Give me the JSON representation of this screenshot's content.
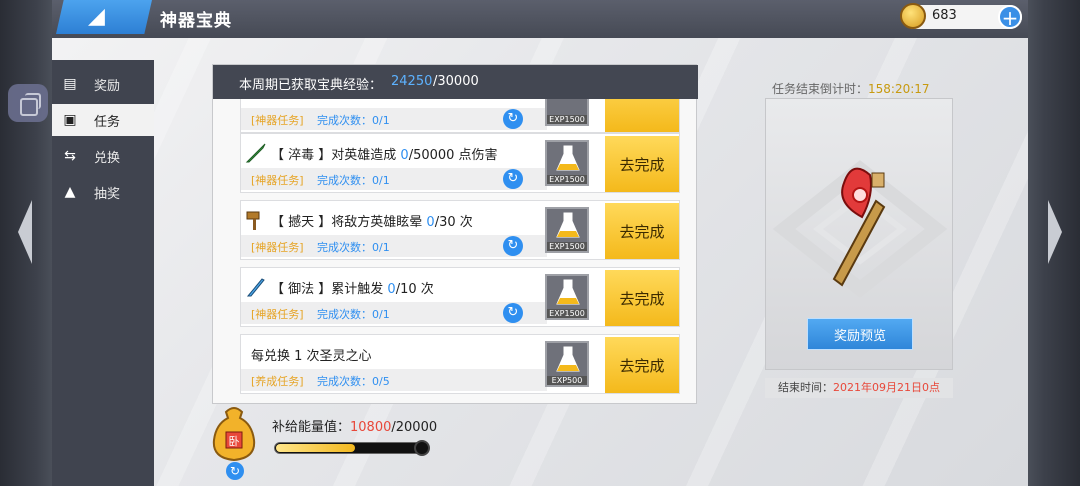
{
  "header": {
    "title": "神器宝典",
    "back_glyph": "◢"
  },
  "currency": {
    "amount": "683",
    "plus": "+"
  },
  "sidebar": {
    "items": [
      {
        "label": "奖励",
        "icon": "reward-icon"
      },
      {
        "label": "任务",
        "icon": "task-icon"
      },
      {
        "label": "兑换",
        "icon": "exchange-icon"
      },
      {
        "label": "抽奖",
        "icon": "lottery-icon"
      }
    ]
  },
  "panel": {
    "exp_label": "本周期已获取宝典经验：",
    "exp_current": "24250",
    "exp_total": "/30000"
  },
  "tasks": [
    {
      "prefix": "",
      "title": "",
      "progress_current": "",
      "progress_rest": "",
      "tag": "[神器任务]",
      "count_label": "完成次数：0/1",
      "exp_label": "EXP1500",
      "go_label": ""
    },
    {
      "prefix": "【 淬毒 】",
      "title": "对英雄造成 ",
      "progress_current": "0",
      "progress_rest": "/50000 点伤害",
      "tag": "[神器任务]",
      "count_label": "完成次数：0/1",
      "exp_label": "EXP1500",
      "go_label": "去完成"
    },
    {
      "prefix": "【 撼天 】",
      "title": "将敌方英雄眩晕 ",
      "progress_current": "0",
      "progress_rest": "/30 次",
      "tag": "[神器任务]",
      "count_label": "完成次数：0/1",
      "exp_label": "EXP1500",
      "go_label": "去完成"
    },
    {
      "prefix": "【 御法 】",
      "title": "累计触发 ",
      "progress_current": "0",
      "progress_rest": "/10 次",
      "tag": "[神器任务]",
      "count_label": "完成次数：0/1",
      "exp_label": "EXP1500",
      "go_label": "去完成"
    },
    {
      "prefix": "",
      "title": "每兑换 1 次圣灵之心",
      "progress_current": "",
      "progress_rest": "",
      "tag": "[养成任务]",
      "count_label": "完成次数：0/5",
      "exp_label": "EXP500",
      "go_label": "去完成"
    }
  ],
  "energy": {
    "label": "补给能量值：",
    "current": "10800",
    "total": "/20000",
    "fill_fraction": 0.54,
    "bag_text": "卧"
  },
  "reward": {
    "countdown_label": "任务结束倒计时：",
    "countdown_value": "158:20:17",
    "preview_button": "奖励预览",
    "end_label": "结束时间：",
    "end_value": "2021年09月21日0点"
  },
  "colors": {
    "accent_blue": "#2f8ff0",
    "gold": "#f4b91b",
    "warning_red": "#e8483a"
  }
}
